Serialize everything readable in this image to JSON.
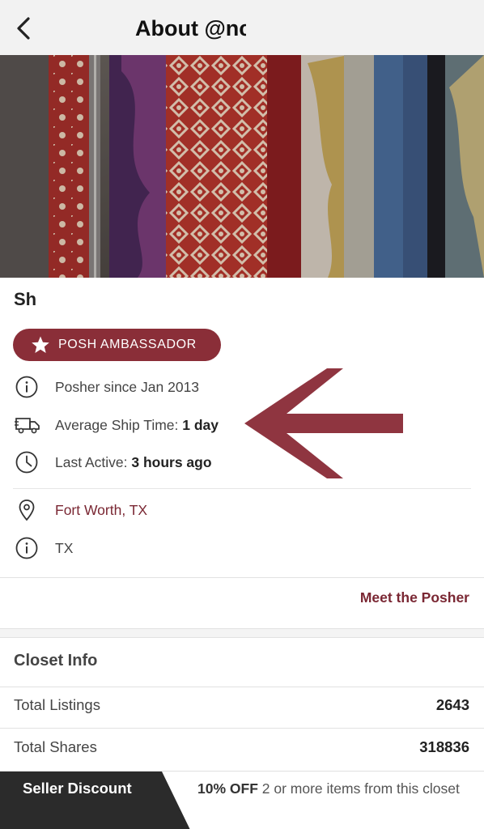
{
  "header": {
    "back_icon": "chevron-left-icon",
    "title": "About @nc"
  },
  "profile": {
    "name": "Sh",
    "badge": {
      "icon": "star-icon",
      "label": "POSH AMBASSADOR"
    },
    "details": [
      {
        "icon": "info-icon",
        "label": "Posher since Jan 2013",
        "value": ""
      },
      {
        "icon": "truck-icon",
        "label": "Average Ship Time: ",
        "value": "1 day"
      },
      {
        "icon": "clock-icon",
        "label": "Last Active: ",
        "value": "3 hours ago"
      }
    ],
    "location": {
      "icon": "location-pin-icon",
      "label": "Fort Worth, TX"
    },
    "state": {
      "icon": "info-icon",
      "label": "TX"
    },
    "meet_link": "Meet the Posher"
  },
  "closet": {
    "title": "Closet Info",
    "stats": [
      {
        "label": "Total Listings",
        "value": "2643"
      },
      {
        "label": "Total Shares",
        "value": "318836"
      }
    ]
  },
  "footer": {
    "tag": "Seller Discount",
    "offer_bold": "10% OFF",
    "offer_rest": " 2 or more items from this closet"
  },
  "colors": {
    "brand": "#8a2e38",
    "link": "#7a2733",
    "arrow": "#8f3540",
    "footer_tag": "#2b2b2b"
  }
}
